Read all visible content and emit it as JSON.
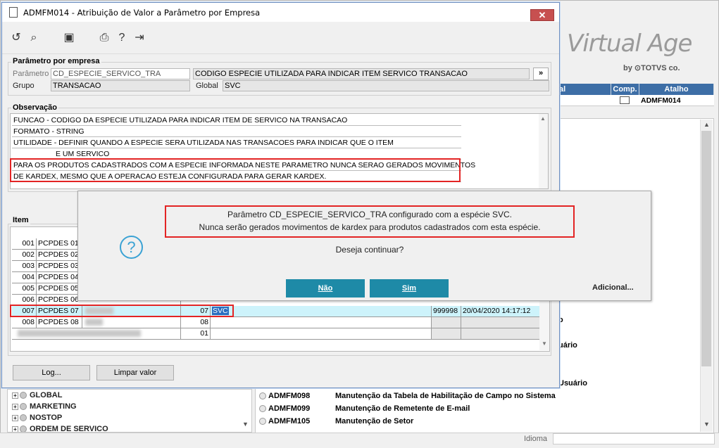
{
  "window": {
    "title": "ADMFM014 - Atribuição de Valor a Parâmetro por Empresa",
    "close": "✕"
  },
  "brand": {
    "name": "Virtual Age",
    "sub": "by ⊙TOTVS co."
  },
  "bg_table": {
    "headers": [
      "al",
      "Comp.",
      "Atalho"
    ],
    "row_shortcut": "ADMFM014"
  },
  "bg_fragments": [
    "o",
    "uário",
    "Usuário"
  ],
  "bg_menu": [
    {
      "code": "ADMFM098",
      "label": "Manutenção da Tabela de Habilitação de Campo no Sistema"
    },
    {
      "code": "ADMFM099",
      "label": "Manutenção de Remetente de E-mail"
    },
    {
      "code": "ADMFM105",
      "label": "Manutenção de Setor"
    }
  ],
  "tree": [
    "GLOBAL",
    "MARKETING",
    "NOSTOP",
    "ORDEM DE SERVICO"
  ],
  "status": {
    "idioma": "Idioma"
  },
  "parametro": {
    "legend": "Parâmetro por empresa",
    "label_parametro": "Parâmetro",
    "parametro_value": "CD_ESPECIE_SERVICO_TRA",
    "descricao": "CODIGO ESPECIE UTILIZADA PARA INDICAR ITEM SERVICO TRANSACAO",
    "expand": "»",
    "label_grupo": "Grupo",
    "grupo_value": "TRANSACAO",
    "label_global": "Global",
    "global_value": "SVC"
  },
  "observacao": {
    "legend": "Observação",
    "lines": [
      "FUNCAO - CODIGO DA ESPECIE UTILIZADA PARA INDICAR ITEM DE SERVICO NA TRANSACAO",
      "FORMATO - STRING",
      "UTILIDADE - DEFINIR QUANDO A ESPECIE SERA UTILIZADA NAS TRANSACOES PARA INDICAR QUE O ITEM",
      "E UM SERVICO",
      "PARA OS PRODUTOS CADASTRADOS COM A ESPECIE INFORMADA NESTE PARAMETRO NUNCA SERAO GERADOS MOVIMENTOS",
      "DE KARDEX, MESMO QUE A OPERACAO ESTEJA CONFIGURADA PARA GERAR KARDEX."
    ]
  },
  "item": {
    "legend": "Item",
    "rows": [
      {
        "code": "001",
        "name": "PCPDES 01",
        "num": "",
        "valor": "",
        "user": "",
        "date": ""
      },
      {
        "code": "002",
        "name": "PCPDES 02",
        "num": "",
        "valor": "",
        "user": "",
        "date": ""
      },
      {
        "code": "003",
        "name": "PCPDES 03",
        "num": "",
        "valor": "",
        "user": "",
        "date": ""
      },
      {
        "code": "004",
        "name": "PCPDES 04",
        "num": "",
        "valor": "",
        "user": "",
        "date": ""
      },
      {
        "code": "005",
        "name": "PCPDES 05",
        "num": "",
        "valor": "",
        "user": "",
        "date": ""
      },
      {
        "code": "006",
        "name": "PCPDES 06",
        "num": "",
        "valor": "",
        "user": "",
        "date": ""
      },
      {
        "code": "007",
        "name": "PCPDES 07",
        "num": "07",
        "valor": "SVC",
        "user": "999998",
        "date": "20/04/2020 14:17:12"
      },
      {
        "code": "008",
        "name": "PCPDES 08",
        "num": "08",
        "valor": "",
        "user": "",
        "date": ""
      },
      {
        "code": "",
        "name": "",
        "num": "01",
        "valor": "",
        "user": "",
        "date": ""
      }
    ]
  },
  "buttons": {
    "log": "Log...",
    "limpar": "Limpar valor"
  },
  "dialog": {
    "line1": "Parâmetro CD_ESPECIE_SERVICO_TRA configurado com a espécie SVC.",
    "line2": "Nunca serão gerados movimentos de kardex para produtos cadastrados com esta espécie.",
    "question": "Deseja continuar?",
    "no": "Não",
    "yes": "Sim",
    "adicional": "Adicional..."
  },
  "colors": {
    "accent": "#1e8aa7",
    "highlight": "#e32424",
    "selected_row": "#cdf3fb",
    "header": "#3d6ea6"
  }
}
